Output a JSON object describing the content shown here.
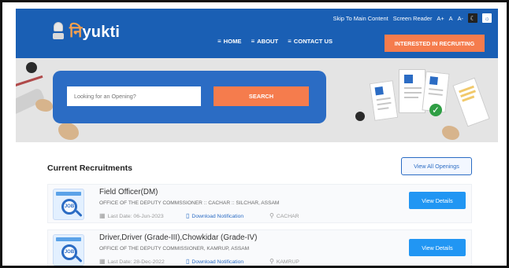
{
  "header": {
    "utility": {
      "skip_link": "Skip To Main Content",
      "screen_reader": "Screen Reader",
      "font_plus": "A+",
      "font_normal": "A",
      "font_minus": "A-",
      "theme_dark_icon": "moon-icon",
      "theme_light_icon": "sun-icon"
    },
    "logo": {
      "prefix": "नि",
      "text": "yukti",
      "emblem_icon": "national-emblem-icon"
    },
    "nav": [
      {
        "label": "HOME",
        "icon": "menu-icon"
      },
      {
        "label": "ABOUT",
        "icon": "menu-icon"
      },
      {
        "label": "CONTACT US",
        "icon": "menu-icon"
      }
    ],
    "cta_label": "INTERESTED IN RECRUITING"
  },
  "hero": {
    "search_placeholder": "Looking for an Opening?",
    "search_button": "SEARCH"
  },
  "recruitments": {
    "title": "Current Recruitments",
    "view_all": "View All Openings",
    "jobs": [
      {
        "title": "Field Officer(DM)",
        "office": "OFFICE OF THE DEPUTY COMMSSIONER :: CACHAR :: SILCHAR, ASSAM",
        "last_date": "Last Date: 06-Jun-2023",
        "download": "Download Notification",
        "location": "CACHAR",
        "action": "View Details",
        "icon_label": "JOB"
      },
      {
        "title": "Driver,Driver (Grade-III),Chowkidar (Grade-IV)",
        "office": "OFFICE OF THE DEPUTY COMMISSIONER, KAMRUP, ASSAM",
        "last_date": "Last Date: 28-Dec-2022",
        "download": "Download Notification",
        "location": "KAMRUP",
        "action": "View Details",
        "icon_label": "JOB"
      }
    ]
  },
  "colors": {
    "header_blue": "#1a5fb4",
    "accent_orange": "#f57c4d",
    "panel_blue": "#2b6cc4",
    "button_blue": "#2196f3"
  }
}
